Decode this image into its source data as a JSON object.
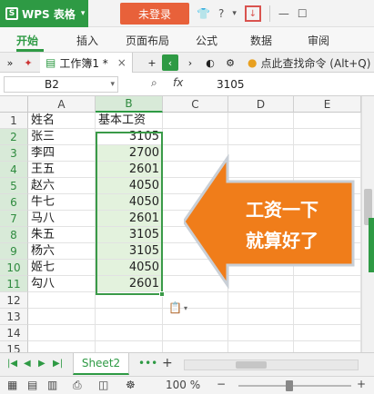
{
  "titlebar": {
    "app_name": "WPS 表格",
    "login_label": "未登录",
    "icons": [
      "shirt-icon",
      "help-icon",
      "download-icon",
      "minimize-icon",
      "maximize-icon"
    ]
  },
  "ribbon": {
    "tabs": [
      "开始",
      "插入",
      "页面布局",
      "公式",
      "数据",
      "审阅"
    ]
  },
  "tabstrip": {
    "doc_name": "工作簿1 *",
    "close_glyph": "×",
    "add_glyph": "+",
    "search_label": "点此查找命令 (Alt+Q)"
  },
  "formulabar": {
    "cell_ref": "B2",
    "fx_label": "fx",
    "value": "3105"
  },
  "grid": {
    "columns": [
      "A",
      "B",
      "C",
      "D",
      "E"
    ],
    "rows": [
      "1",
      "2",
      "3",
      "4",
      "5",
      "6",
      "7",
      "8",
      "9",
      "10",
      "11",
      "12",
      "13",
      "14",
      "15"
    ],
    "header_row": {
      "a": "姓名",
      "b": "基本工资"
    },
    "data": [
      {
        "name": "张三",
        "salary": "3105"
      },
      {
        "name": "李四",
        "salary": "2700"
      },
      {
        "name": "王五",
        "salary": "2601"
      },
      {
        "name": "赵六",
        "salary": "4050"
      },
      {
        "name": "牛七",
        "salary": "4050"
      },
      {
        "name": "马八",
        "salary": "2601"
      },
      {
        "name": "朱五",
        "salary": "3105"
      },
      {
        "name": "杨六",
        "salary": "3105"
      },
      {
        "name": "姬七",
        "salary": "4050"
      },
      {
        "name": "勾八",
        "salary": "2601"
      }
    ]
  },
  "callout": {
    "line1": "工资一下",
    "line2": "就算好了",
    "color": "#f07d1a"
  },
  "sheets": {
    "active": "Sheet2",
    "more_glyph": "•••",
    "add_glyph": "+"
  },
  "status": {
    "zoom": "100 %"
  },
  "colors": {
    "brand_green": "#2e9a44",
    "login_orange": "#e8613a",
    "selection_fill": "#e3f2dd"
  }
}
